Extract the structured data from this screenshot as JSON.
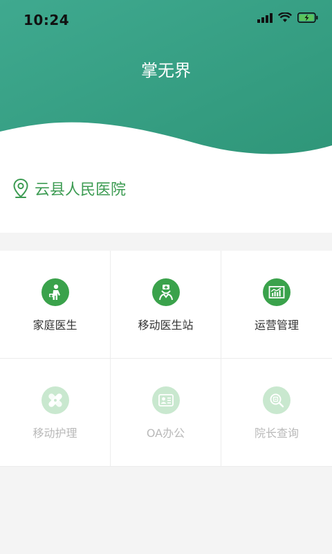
{
  "status_bar": {
    "time": "10:24"
  },
  "header": {
    "title": "掌无界"
  },
  "hospital": {
    "name": "云县人民医院",
    "icon": "location-pin-icon"
  },
  "colors": {
    "accent": "#3aa24b",
    "header_green": "#3a9e86",
    "inactive_icon_bg": "#c9e8cf"
  },
  "modules": [
    {
      "label": "家庭医生",
      "icon": "family-doctor-icon",
      "enabled": true
    },
    {
      "label": "移动医生站",
      "icon": "doctor-station-icon",
      "enabled": true
    },
    {
      "label": "运营管理",
      "icon": "operations-chart-icon",
      "enabled": true
    },
    {
      "label": "移动护理",
      "icon": "bandage-icon",
      "enabled": false
    },
    {
      "label": "OA办公",
      "icon": "id-card-icon",
      "enabled": false
    },
    {
      "label": "院长查询",
      "icon": "search-magnifier-icon",
      "enabled": false
    }
  ]
}
